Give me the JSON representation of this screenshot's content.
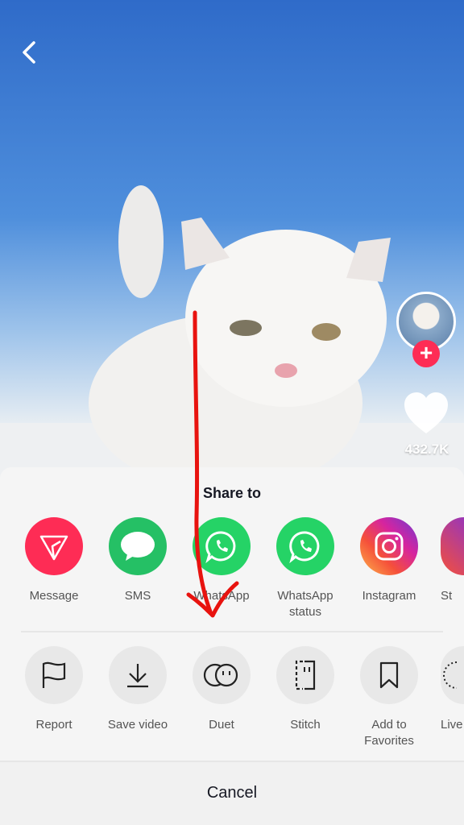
{
  "video": {
    "likes": "432.7K"
  },
  "share": {
    "title": "Share to",
    "apps": [
      {
        "label": "Message",
        "icon": "send-icon",
        "color": "#fe2c55"
      },
      {
        "label": "SMS",
        "icon": "chat-bubble-icon",
        "color": "#25c065"
      },
      {
        "label": "WhatsApp",
        "icon": "whatsapp-icon",
        "color": "#25d366"
      },
      {
        "label": "WhatsApp status",
        "icon": "whatsapp-icon",
        "color": "#25d366"
      },
      {
        "label": "Instagram",
        "icon": "instagram-icon",
        "color": "#d6249f"
      },
      {
        "label": "St",
        "icon": "stories-icon",
        "color": "#9b36b7"
      }
    ],
    "actions": [
      {
        "label": "Report",
        "icon": "flag-icon"
      },
      {
        "label": "Save video",
        "icon": "download-icon"
      },
      {
        "label": "Duet",
        "icon": "duet-icon"
      },
      {
        "label": "Stitch",
        "icon": "stitch-icon"
      },
      {
        "label": "Add to Favorites",
        "icon": "bookmark-icon"
      },
      {
        "label": "Live",
        "icon": "live-photo-icon"
      }
    ],
    "cancel": "Cancel"
  },
  "annotation_color": "#e8130f"
}
